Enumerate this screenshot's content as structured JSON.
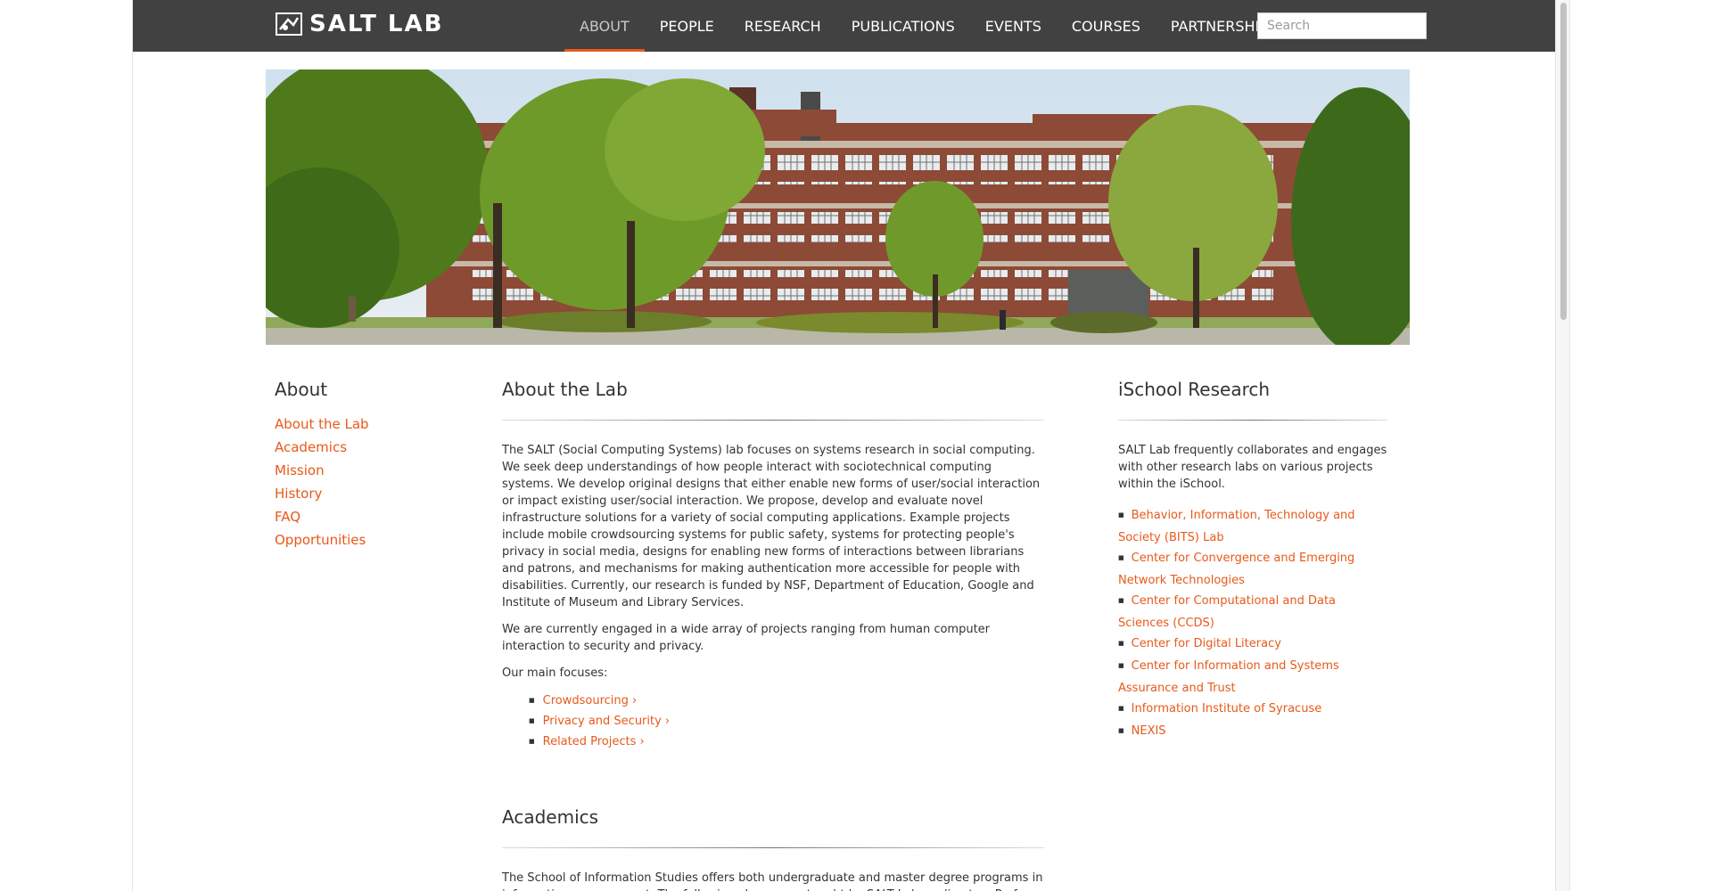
{
  "brand": {
    "name": "SALT LAB"
  },
  "nav": {
    "items": [
      "ABOUT",
      "PEOPLE",
      "RESEARCH",
      "PUBLICATIONS",
      "EVENTS",
      "COURSES",
      "PARTNERSHIPS"
    ],
    "active": "ABOUT"
  },
  "search": {
    "placeholder": "Search",
    "value": ""
  },
  "sidebar": {
    "title": "About",
    "items": [
      "About the Lab",
      "Academics",
      "Mission",
      "History",
      "FAQ",
      "Opportunities"
    ]
  },
  "main": {
    "about": {
      "title": "About the Lab",
      "p1": "The SALT (Social Computing Systems) lab focuses on systems research in social computing. We seek deep understandings of how people interact with sociotechnical computing systems. We develop original designs that either enable new forms of user/social interaction or impact existing user/social interaction. We propose, develop and evaluate novel infrastructure solutions for a variety of social computing applications. Example projects include mobile crowdsourcing systems for public safety, systems for protecting people's privacy in social media, designs for enabling new forms of interactions between librarians and patrons, and mechanisms for making authentication more accessible for people with disabilities. Currently, our research is funded by NSF, Department of Education, Google and Institute of Museum and Library Services.",
      "p2": "We are currently engaged in a wide array of projects ranging from human computer interaction to security and privacy.",
      "p3": "Our main focuses:",
      "focuses": [
        "Crowdsourcing ›",
        "Privacy and Security ›",
        "Related Projects ›"
      ]
    },
    "academics": {
      "title": "Academics",
      "p1": "The School of Information Studies offers both undergraduate and master degree programs in information management. The following classes are taught by SALT Lab co-directors Prof. Yang Wang and Prof. Yun Huang :"
    }
  },
  "right": {
    "title": "iSchool Research",
    "intro": "SALT Lab frequently collaborates and engages with other research labs on various projects within the iSchool.",
    "labs": [
      "Behavior, Information, Technology and Society (BITS) Lab",
      "Center for Convergence and Emerging Network Technologies",
      "Center for Computational and Data Sciences (CCDS)",
      "Center for Digital Literacy",
      "Center for Information and Systems Assurance and Trust",
      "Information Institute of Syracuse",
      "NEXIS"
    ]
  },
  "colors": {
    "accent": "#e8591a",
    "navbar": "#414141",
    "text": "#333333"
  },
  "icons": {
    "logo": "salt-lab-logo-mark"
  },
  "hero": {
    "alt": "photo of brick campus building with trees"
  }
}
